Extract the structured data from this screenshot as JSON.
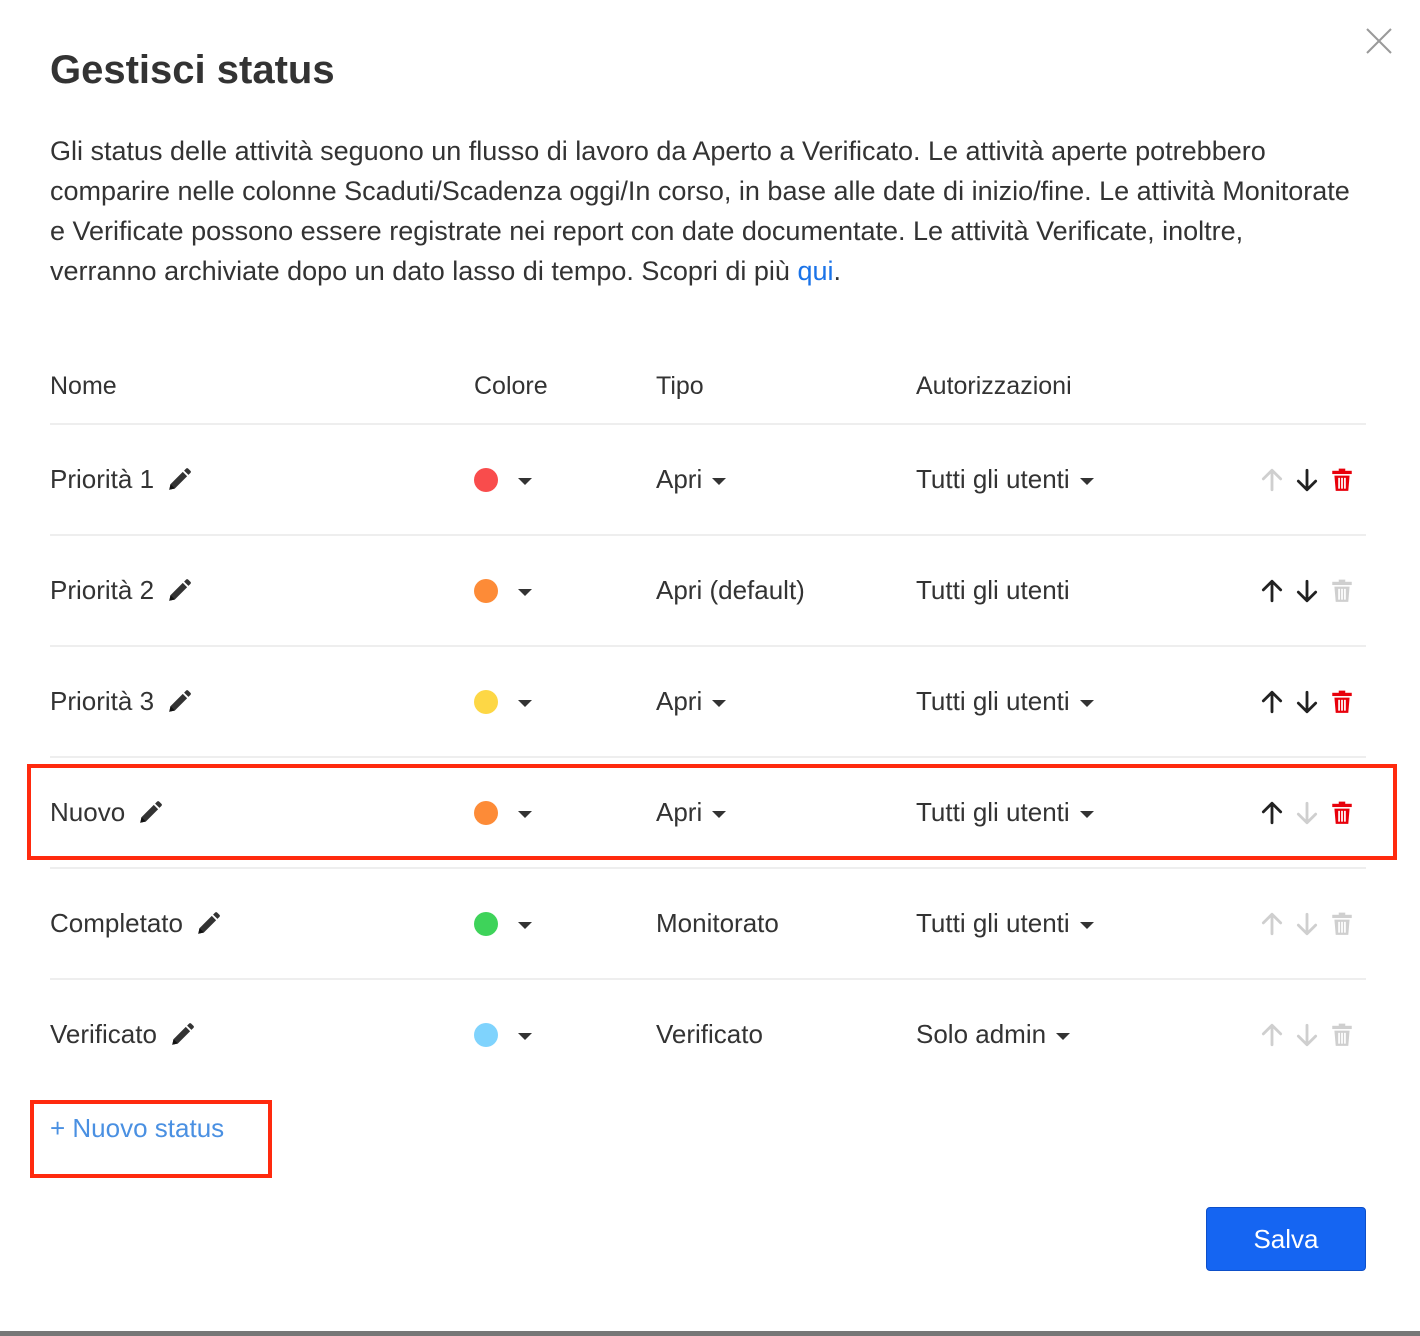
{
  "modal": {
    "title": "Gestisci status",
    "description": "Gli status delle attività seguono un flusso di lavoro da Aperto a Verificato. Le attività aperte potrebbero comparire nelle colonne Scaduti/Scadenza oggi/In corso, in base alle date di inizio/fine. Le attività Monitorate e Verificate possono essere registrate nei report con date documentate. Le attività Verificate, inoltre, verranno archiviate dopo un dato lasso di tempo. Scopri di più ",
    "link_label": "qui",
    "link_suffix": "."
  },
  "table": {
    "headers": {
      "name": "Nome",
      "color": "Colore",
      "type": "Tipo",
      "permissions": "Autorizzazioni"
    },
    "rows": [
      {
        "name": "Priorità 1",
        "color": "#f94c4c",
        "type": "Apri",
        "type_dropdown": true,
        "permissions": "Tutti gli utenti",
        "perm_dropdown": true,
        "up_enabled": false,
        "down_enabled": true,
        "delete_enabled": true
      },
      {
        "name": "Priorità 2",
        "color": "#fd8b37",
        "type": "Apri (default)",
        "type_dropdown": false,
        "permissions": "Tutti gli utenti",
        "perm_dropdown": false,
        "up_enabled": true,
        "down_enabled": true,
        "delete_enabled": false
      },
      {
        "name": "Priorità 3",
        "color": "#fdd745",
        "type": "Apri",
        "type_dropdown": true,
        "permissions": "Tutti gli utenti",
        "perm_dropdown": true,
        "up_enabled": true,
        "down_enabled": true,
        "delete_enabled": true
      },
      {
        "name": "Nuovo",
        "color": "#fd8b37",
        "type": "Apri",
        "type_dropdown": true,
        "permissions": "Tutti gli utenti",
        "perm_dropdown": true,
        "up_enabled": true,
        "down_enabled": false,
        "delete_enabled": true
      },
      {
        "name": "Completato",
        "color": "#3ed35a",
        "type": "Monitorato",
        "type_dropdown": false,
        "permissions": "Tutti gli utenti",
        "perm_dropdown": true,
        "up_enabled": false,
        "down_enabled": false,
        "delete_enabled": false
      },
      {
        "name": "Verificato",
        "color": "#7fd3fd",
        "type": "Verificato",
        "type_dropdown": false,
        "permissions": "Solo admin",
        "perm_dropdown": true,
        "up_enabled": false,
        "down_enabled": false,
        "delete_enabled": false
      }
    ]
  },
  "new_status_label": "+ Nuovo status",
  "save_label": "Salva",
  "icons": {
    "close": "close-icon",
    "edit": "pencil-icon",
    "up": "arrow-up-icon",
    "down": "arrow-down-icon",
    "delete": "trash-icon",
    "dropdown": "caret-down-icon"
  },
  "colors": {
    "accent": "#1565f2",
    "link": "#1a73e8",
    "new_status_link": "#4a90e2",
    "delete_active": "#e8000b",
    "icon_active": "#222222",
    "icon_disabled": "#cfcfcf",
    "highlight": "#ff2a0e"
  }
}
